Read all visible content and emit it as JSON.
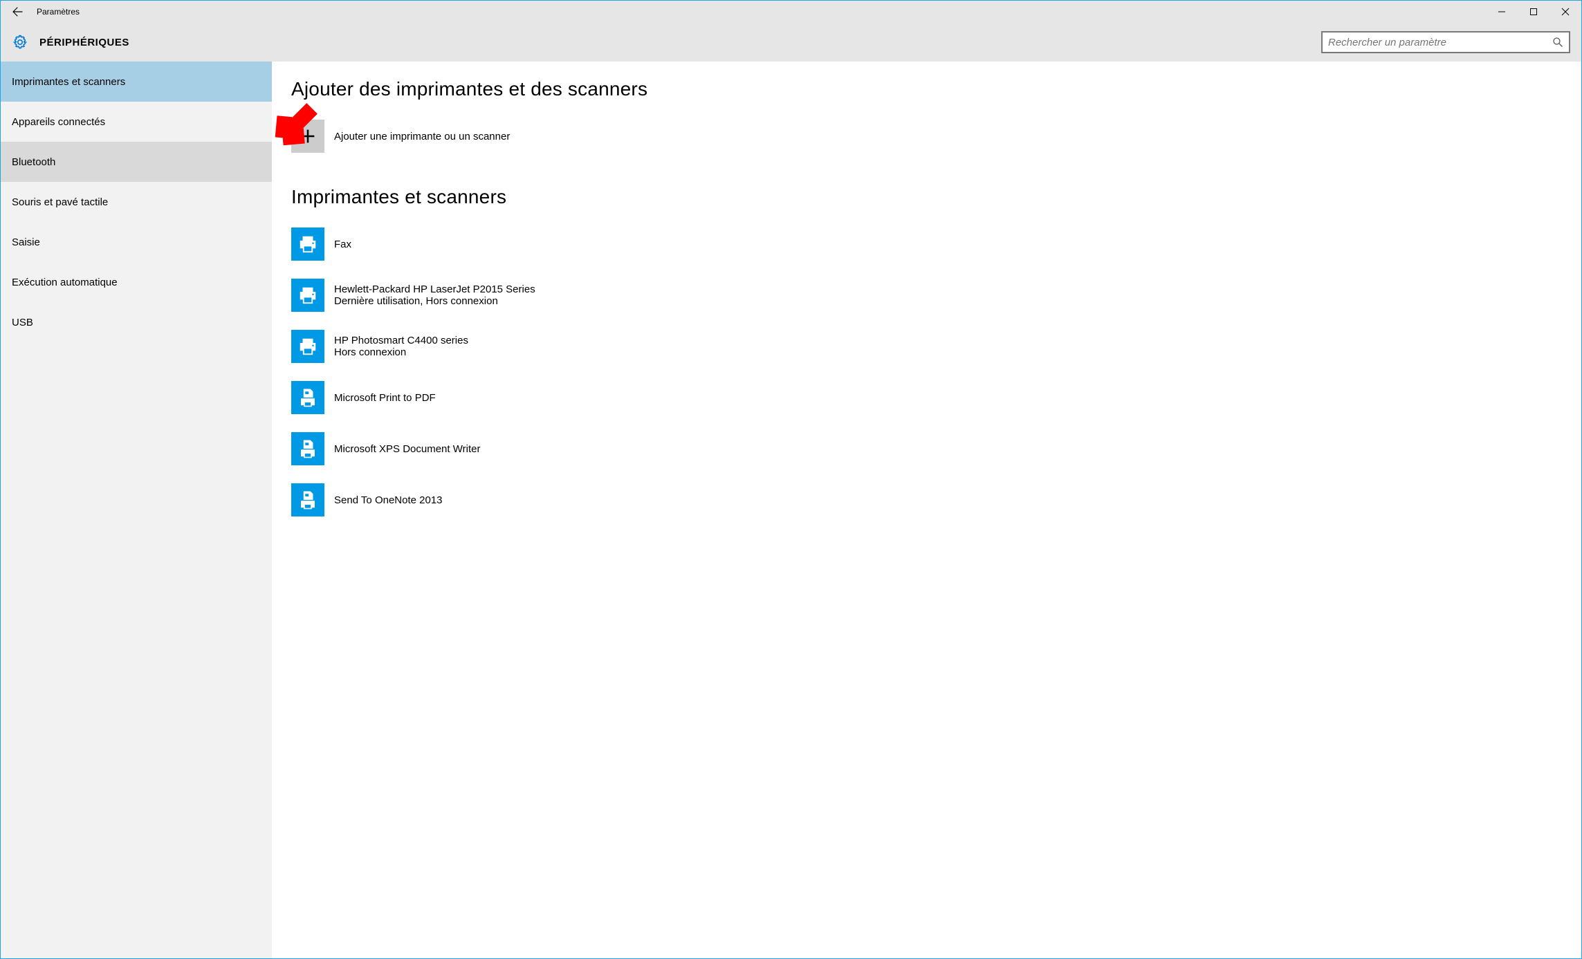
{
  "titlebar": {
    "app_title": "Paramètres"
  },
  "header": {
    "category": "PÉRIPHÉRIQUES",
    "search_placeholder": "Rechercher un paramètre"
  },
  "sidebar": {
    "items": [
      {
        "label": "Imprimantes et scanners",
        "state": "selected"
      },
      {
        "label": "Appareils connectés",
        "state": ""
      },
      {
        "label": "Bluetooth",
        "state": "hovered"
      },
      {
        "label": "Souris et pavé tactile",
        "state": ""
      },
      {
        "label": "Saisie",
        "state": ""
      },
      {
        "label": "Exécution automatique",
        "state": ""
      },
      {
        "label": "USB",
        "state": ""
      }
    ]
  },
  "content": {
    "add_section": {
      "title": "Ajouter des imprimantes et des scanners",
      "add_label": "Ajouter une imprimante ou un scanner"
    },
    "list_section": {
      "title": "Imprimantes et scanners",
      "items": [
        {
          "name": "Fax",
          "status": "",
          "icon": "printer"
        },
        {
          "name": "Hewlett-Packard HP LaserJet P2015 Series",
          "status": "Dernière utilisation, Hors connexion",
          "icon": "printer"
        },
        {
          "name": "HP Photosmart C4400 series",
          "status": "Hors connexion",
          "icon": "printer"
        },
        {
          "name": "Microsoft Print to PDF",
          "status": "",
          "icon": "document-printer"
        },
        {
          "name": "Microsoft XPS Document Writer",
          "status": "",
          "icon": "document-printer"
        },
        {
          "name": "Send To OneNote 2013",
          "status": "",
          "icon": "document-printer"
        }
      ]
    }
  },
  "colors": {
    "accent": "#0078d7",
    "icon_tile": "#0099e5",
    "sidebar_bg": "#f2f2f2",
    "sidebar_selected": "#a6cfe6",
    "sidebar_hover": "#d9d9d9",
    "annotation": "#ff0000"
  }
}
